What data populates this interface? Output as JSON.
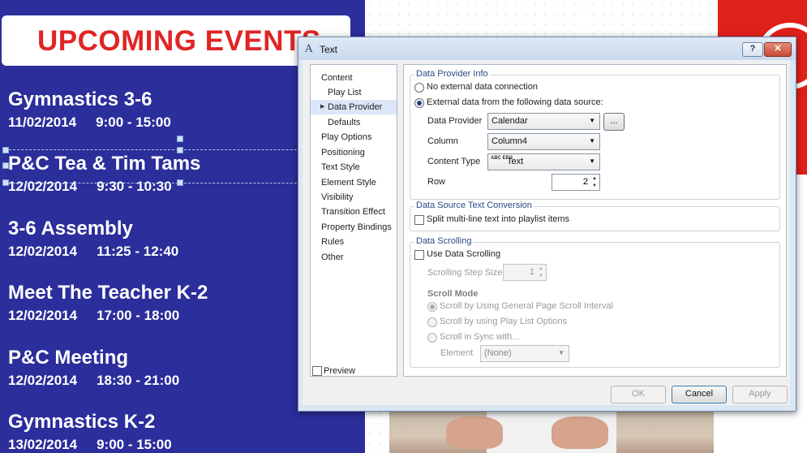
{
  "signage": {
    "title": "UPCOMING EVENTS",
    "events": [
      {
        "name": "Gymnastics 3-6",
        "date": "11/02/2014",
        "time": "9:00 - 15:00"
      },
      {
        "name": "P&C Tea & Tim Tams",
        "date": "12/02/2014",
        "time": "9:30 - 10:30"
      },
      {
        "name": "3-6 Assembly",
        "date": "12/02/2014",
        "time": "11:25 - 12:40"
      },
      {
        "name": "Meet The Teacher K-2",
        "date": "12/02/2014",
        "time": "17:00 - 18:00"
      },
      {
        "name": "P&C Meeting",
        "date": "12/02/2014",
        "time": "18:30 - 21:00"
      },
      {
        "name": "Gymnastics K-2",
        "date": "13/02/2014",
        "time": "9:00 - 15:00"
      }
    ],
    "colors": {
      "background": "#2b2e9b",
      "title": "#e02525",
      "accent": "#e0201b"
    }
  },
  "dialog": {
    "title": "Text",
    "help_label": "?",
    "close_label": "✕",
    "nav": [
      {
        "label": "Content"
      },
      {
        "label": "Play List"
      },
      {
        "label": "Data Provider"
      },
      {
        "label": "Defaults"
      },
      {
        "label": "Play Options"
      },
      {
        "label": "Positioning"
      },
      {
        "label": "Text Style"
      },
      {
        "label": "Element Style"
      },
      {
        "label": "Visibility"
      },
      {
        "label": "Transition Effect"
      },
      {
        "label": "Property Bindings"
      },
      {
        "label": "Rules"
      },
      {
        "label": "Other"
      }
    ],
    "active_nav": "Data Provider",
    "preview_label": "Preview",
    "provider_group": {
      "title": "Data Provider Info",
      "radio_none": "No external data connection",
      "radio_external": "External data from the following data source:",
      "provider_label": "Data Provider",
      "provider_value": "Calendar",
      "browse_label": "...",
      "column_label": "Column",
      "column_value": "Column4",
      "content_type_label": "Content Type",
      "content_type_value": "Text",
      "content_type_icon": "ABC EFG",
      "row_label": "Row",
      "row_value": "2"
    },
    "conversion_group": {
      "title": "Data Source Text Conversion",
      "split_label": "Split multi-line text into playlist items"
    },
    "scrolling_group": {
      "title": "Data Scrolling",
      "use_label": "Use Data Scrolling",
      "step_label": "Scrolling Step Size",
      "step_value": "1",
      "mode_label": "Scroll Mode",
      "mode_general": "Scroll by Using General Page Scroll Interval",
      "mode_playlist": "Scroll by using Play List Options",
      "mode_sync": "Scroll in Sync with...",
      "element_label": "Element",
      "element_value": "(None)"
    },
    "buttons": {
      "ok": "OK",
      "cancel": "Cancel",
      "apply": "Apply"
    }
  }
}
